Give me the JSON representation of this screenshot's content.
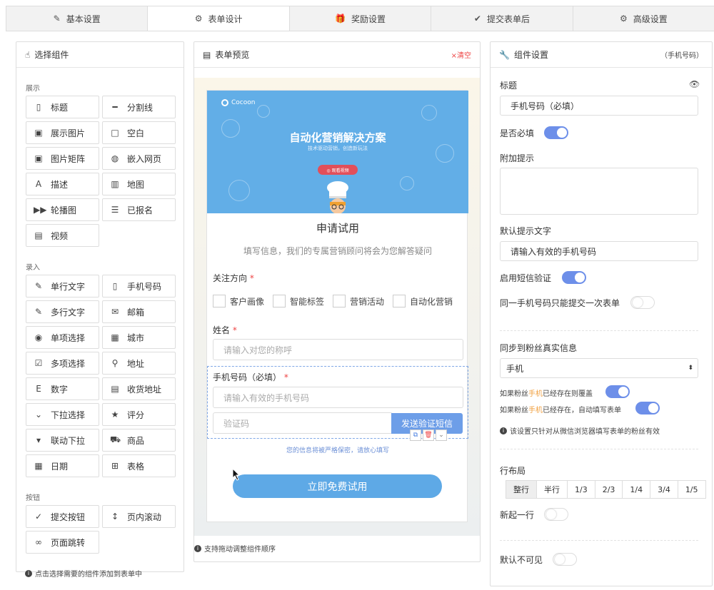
{
  "tabs": [
    {
      "label": "基本设置",
      "icon": "edit-icon",
      "glyph": "✎"
    },
    {
      "label": "表单设计",
      "icon": "gear-icon",
      "glyph": "⚙"
    },
    {
      "label": "奖励设置",
      "icon": "gift-icon",
      "glyph": "🎁"
    },
    {
      "label": "提交表单后",
      "icon": "check-circle-icon",
      "glyph": "✔"
    },
    {
      "label": "高级设置",
      "icon": "gears-icon",
      "glyph": "⚙"
    }
  ],
  "left": {
    "title": "选择组件",
    "sections": {
      "display": "展示",
      "input": "录入",
      "button": "按钮"
    },
    "display_items": [
      {
        "label": "标题",
        "icon": "bookmark-icon",
        "glyph": "▯"
      },
      {
        "label": "分割线",
        "icon": "minus-icon",
        "glyph": "━"
      },
      {
        "label": "展示图片",
        "icon": "image-icon",
        "glyph": "▣"
      },
      {
        "label": "空白",
        "icon": "square-icon",
        "glyph": "□"
      },
      {
        "label": "图片矩阵",
        "icon": "image-grid-icon",
        "glyph": "▣"
      },
      {
        "label": "嵌入网页",
        "icon": "globe-icon",
        "glyph": "◍"
      },
      {
        "label": "描述",
        "icon": "font-icon",
        "glyph": "A"
      },
      {
        "label": "地图",
        "icon": "map-icon",
        "glyph": "▥"
      },
      {
        "label": "轮播图",
        "icon": "fast-forward-icon",
        "glyph": "▶▶"
      },
      {
        "label": "已报名",
        "icon": "list-icon",
        "glyph": "☰"
      },
      {
        "label": "视频",
        "icon": "video-file-icon",
        "glyph": "▤"
      }
    ],
    "input_items": [
      {
        "label": "单行文字",
        "icon": "pencil-icon",
        "glyph": "✎"
      },
      {
        "label": "手机号码",
        "icon": "mobile-icon",
        "glyph": "▯"
      },
      {
        "label": "多行文字",
        "icon": "edit-icon",
        "glyph": "✎"
      },
      {
        "label": "邮箱",
        "icon": "envelope-icon",
        "glyph": "✉"
      },
      {
        "label": "单项选择",
        "icon": "radio-icon",
        "glyph": "◉"
      },
      {
        "label": "城市",
        "icon": "building-icon",
        "glyph": "▦"
      },
      {
        "label": "多项选择",
        "icon": "checkbox-icon",
        "glyph": "☑"
      },
      {
        "label": "地址",
        "icon": "map-marker-icon",
        "glyph": "⚲"
      },
      {
        "label": "数字",
        "icon": "number-icon",
        "glyph": "E"
      },
      {
        "label": "收货地址",
        "icon": "address-card-icon",
        "glyph": "▤"
      },
      {
        "label": "下拉选择",
        "icon": "chevron-circle-down-icon",
        "glyph": "⌄"
      },
      {
        "label": "评分",
        "icon": "star-icon",
        "glyph": "★"
      },
      {
        "label": "联动下拉",
        "icon": "caret-square-down-icon",
        "glyph": "▾"
      },
      {
        "label": "商品",
        "icon": "cart-icon",
        "glyph": "⛟"
      },
      {
        "label": "日期",
        "icon": "calendar-icon",
        "glyph": "▦"
      },
      {
        "label": "表格",
        "icon": "table-icon",
        "glyph": "⊞"
      }
    ],
    "button_items": [
      {
        "label": "提交按钮",
        "icon": "check-circle-icon",
        "glyph": "✓"
      },
      {
        "label": "页内滚动",
        "icon": "arrows-vertical-icon",
        "glyph": "↕"
      },
      {
        "label": "页面跳转",
        "icon": "link-icon",
        "glyph": "∞"
      }
    ],
    "hint": "点击选择需要的组件添加到表单中"
  },
  "mid": {
    "title": "表单预览",
    "clear": "×清空",
    "banner": {
      "logo": "Cocoon",
      "title": "自动化营销解决方案",
      "subtitle": "技术驱动营销，创造新玩法",
      "button": "◎ 观看视频"
    },
    "form_title": "申请试用",
    "form_subtitle": "填写信息，我们的专属营销顾问将会为您解答疑问",
    "focus_label": "关注方向",
    "focus_options": [
      "客户画像",
      "智能标签",
      "营销活动",
      "自动化营销"
    ],
    "name_label": "姓名",
    "name_placeholder": "请输入对您的称呼",
    "phone_label": "手机号码（必填）",
    "phone_placeholder": "请输入有效的手机号码",
    "code_placeholder": "验证码",
    "send_code": "发送验证短信",
    "privacy": "您的信息将被严格保密，请放心填写",
    "submit": "立即免费试用",
    "footer": "支持拖动调整组件顺序"
  },
  "right": {
    "title": "组件设置",
    "tag": "（手机号码）",
    "title_label": "标题",
    "title_value": "手机号码（必填）",
    "required_label": "是否必填",
    "extra_hint_label": "附加提示",
    "default_hint_label": "默认提示文字",
    "default_hint_value": "请输入有效的手机号码",
    "sms_label": "启用短信验证",
    "once_label": "同一手机号码只能提交一次表单",
    "sync_label": "同步到粉丝真实信息",
    "sync_value": "手机",
    "overwrite_pre": "如果粉丝",
    "overwrite_hl": "手机",
    "overwrite_post": "已经存在则覆盖",
    "autofill_pre": "如果粉丝",
    "autofill_hl": "手机",
    "autofill_post": "已经存在，自动填写表单",
    "wechat_note": "该设置只针对从微信浏览器填写表单的粉丝有效",
    "layout_label": "行布局",
    "layout_options": [
      "整行",
      "半行",
      "1/3",
      "2/3",
      "1/4",
      "3/4",
      "1/5"
    ],
    "newline_label": "新起一行",
    "hidden_label": "默认不可见"
  }
}
